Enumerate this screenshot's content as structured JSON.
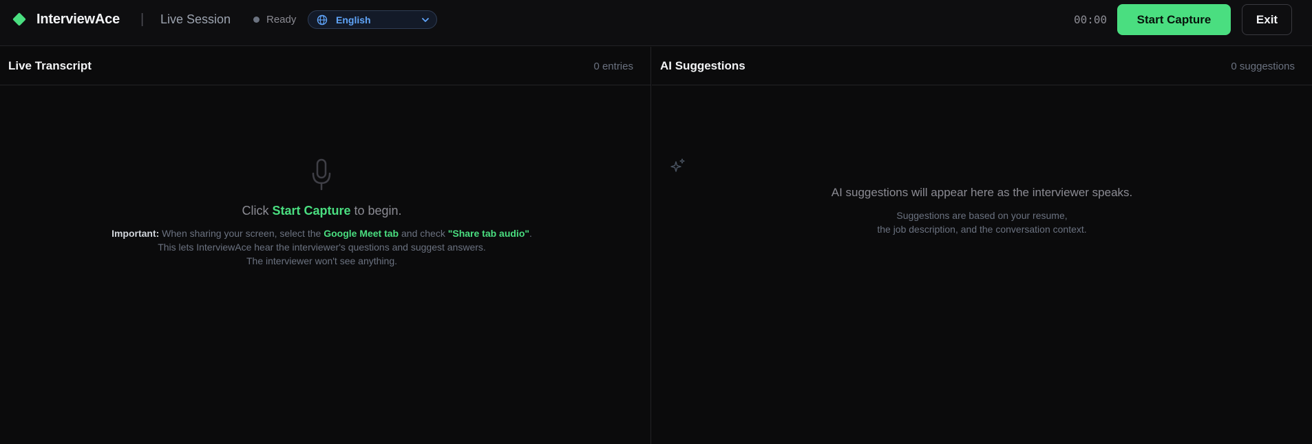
{
  "header": {
    "brand": "InterviewAce",
    "divider": "|",
    "session_label": "Live Session",
    "status": "Ready",
    "language": "English",
    "timer": "00:00",
    "start_button": "Start Capture",
    "exit_button": "Exit"
  },
  "transcript": {
    "title": "Live Transcript",
    "count": "0 entries",
    "prompt_prefix": "Click ",
    "prompt_action": "Start Capture",
    "prompt_suffix": " to begin.",
    "important_label": "Important:",
    "note_part1": " When sharing your screen, select the ",
    "note_highlight1": "Google Meet tab",
    "note_part2": " and check ",
    "note_highlight2": "\"Share tab audio\"",
    "note_part3": ".",
    "note_line2": "This lets InterviewAce hear the interviewer's questions and suggest answers.",
    "note_line3": "The interviewer won't see anything."
  },
  "suggestions": {
    "title": "AI Suggestions",
    "count": "0 suggestions",
    "empty_message": "AI suggestions will appear here as the interviewer speaks.",
    "detail_line1": "Suggestions are based on your resume,",
    "detail_line2": "the job description, and the conversation context."
  },
  "icons": {
    "logo": "diamond-logo-icon",
    "globe": "globe-icon",
    "chevron": "chevron-down-icon",
    "mic": "microphone-icon",
    "sparkle": "sparkle-icon"
  },
  "colors": {
    "accent": "#4ade80",
    "language_accent": "#60a5fa",
    "background": "#0b0b0c",
    "muted_text": "#8b8b93"
  }
}
